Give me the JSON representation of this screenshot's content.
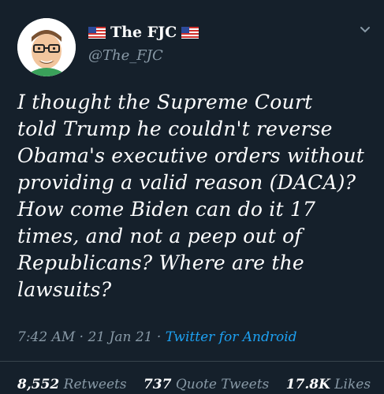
{
  "tweet": {
    "display_name": "The FJC",
    "handle": "@The_FJC",
    "text": "I thought the Supreme Court\ntold Trump he couldn't reverse\nObama's executive orders without\nproviding a valid reason (DACA)?\nHow come Biden can do it 17\ntimes, and not a peep out of\nRepublicans? Where are the\nlawsuits?",
    "time": "7:42 AM",
    "date": "21 Jan 21",
    "source": "Twitter for Android",
    "stats": {
      "retweets_count": "8,552",
      "retweets_label": "Retweets",
      "quotes_count": "737",
      "quotes_label": "Quote Tweets",
      "likes_count": "17.8K",
      "likes_label": "Likes"
    }
  },
  "icons": [
    "us-flag-icon",
    "chevron-down-icon",
    "avatar-cartoon"
  ],
  "colors": {
    "background": "#15202b",
    "text": "#ffffff",
    "secondary": "#8899a6",
    "link": "#1da1f2"
  }
}
